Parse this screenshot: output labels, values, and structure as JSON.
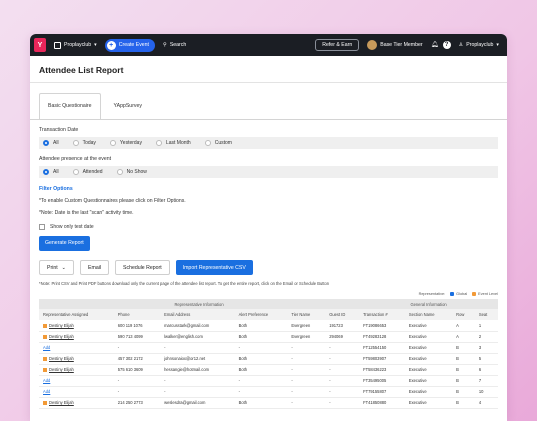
{
  "topbar": {
    "logo": "Y",
    "org_name": "Proplayclub",
    "create_label": "Create Event",
    "search_label": "Search",
    "refer_label": "Refer & Earn",
    "tier_label": "Base Tier Member",
    "user_label": "Proplayclub"
  },
  "page": {
    "title": "Attendee List Report"
  },
  "tabs": [
    {
      "label": "Basic Questionaire"
    },
    {
      "label": "YAppSurvey"
    }
  ],
  "transaction": {
    "label": "Transaction Date",
    "options": [
      "All",
      "Today",
      "Yesterday",
      "Last Month",
      "Custom"
    ],
    "selected": "All"
  },
  "presence": {
    "label": "Attendee presence at the event",
    "options": [
      "All",
      "Attended",
      "No Show"
    ],
    "selected": "All"
  },
  "filter_options_label": "Filter Options",
  "notes": [
    "*To enable Custom Questionnaires please click on Filter Options.",
    "*Note: Date is the last \"scan\" activity time."
  ],
  "test_date_label": "Show only test date",
  "generate_label": "Generate Report",
  "actions": {
    "print": "Print",
    "email": "Email",
    "schedule": "Schedule Report",
    "import": "Import Representative CSV"
  },
  "small_note": "*Note: Print CSV and Print PDF buttons download only the current page of the attendee list report. To get the entire report, click on the Email or Schedule Button",
  "legend": {
    "title": "Representative:",
    "items": [
      {
        "label": "Global",
        "color": "#1a6fe0"
      },
      {
        "label": "Event Level",
        "color": "#f29a37"
      }
    ]
  },
  "table": {
    "group_left": "Representative Information",
    "group_right": "General Information",
    "columns": [
      "Representative Assigned",
      "Phone",
      "Email Address",
      "Alert Preference",
      "Tier Name",
      "Guest ID",
      "Transaction #",
      "Section Name",
      "Row",
      "Seat"
    ],
    "rows": [
      {
        "rep": "Destiny Elijah",
        "rep_link": false,
        "phone": "600 119 1076",
        "email": "marcusstark@gmail.com",
        "alert": "Both",
        "tier": "Evergreen",
        "guest": "191723",
        "txn": "FT19086653",
        "section": "Executive",
        "row": "A",
        "seat": "1"
      },
      {
        "rep": "Destiny Elijah",
        "rep_link": false,
        "phone": "590 713 4099",
        "email": "lwalker@english.com",
        "alert": "Both",
        "tier": "Evergreen",
        "guest": "294069",
        "txn": "FT49283128",
        "section": "Executive",
        "row": "A",
        "seat": "2"
      },
      {
        "rep": "Add",
        "rep_link": true,
        "phone": "-",
        "email": "-",
        "alert": "-",
        "tier": "-",
        "guest": "-",
        "txn": "FT12554150",
        "section": "Executive",
        "row": "B",
        "seat": "3"
      },
      {
        "rep": "Destiny Elijah",
        "rep_link": false,
        "phone": "457 302 2172",
        "email": "johnsonaiox@or12.net",
        "alert": "Both",
        "tier": "-",
        "guest": "-",
        "txn": "FT59803907",
        "section": "Executive",
        "row": "B",
        "seat": "5"
      },
      {
        "rep": "Destiny Elijah",
        "rep_link": false,
        "phone": "575 610 3609",
        "email": "hessangie@hotmail.com",
        "alert": "Both",
        "tier": "-",
        "guest": "-",
        "txn": "FT58436223",
        "section": "Executive",
        "row": "B",
        "seat": "6"
      },
      {
        "rep": "Add",
        "rep_link": true,
        "phone": "-",
        "email": "-",
        "alert": "-",
        "tier": "-",
        "guest": "-",
        "txn": "FT35495005",
        "section": "Executive",
        "row": "B",
        "seat": "7"
      },
      {
        "rep": "Add",
        "rep_link": true,
        "phone": "-",
        "email": "-",
        "alert": "-",
        "tier": "-",
        "guest": "-",
        "txn": "FT79155807",
        "section": "Executive",
        "row": "B",
        "seat": "10"
      },
      {
        "rep": "Destiny Elijah",
        "rep_link": false,
        "phone": "214 250 2773",
        "email": "weslesdra@gmail.com",
        "alert": "Both",
        "tier": "-",
        "guest": "-",
        "txn": "FT41850880",
        "section": "Executive",
        "row": "B",
        "seat": "4"
      }
    ]
  }
}
